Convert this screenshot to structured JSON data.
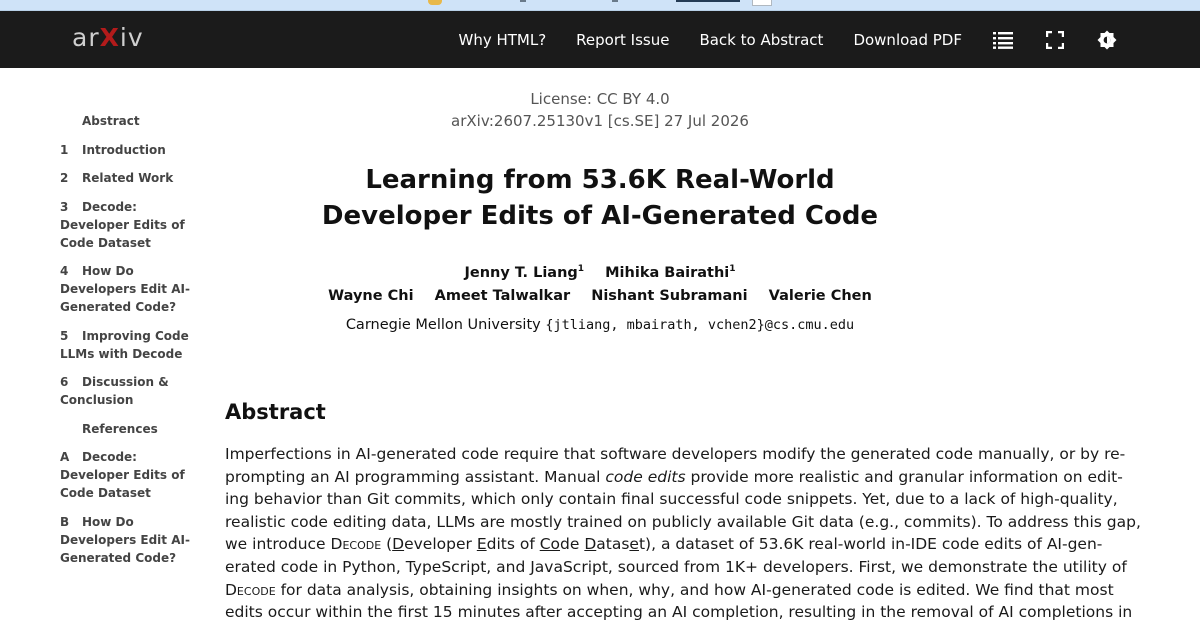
{
  "nav": {
    "logo": "arXiv",
    "links": [
      "Why HTML?",
      "Report Issue",
      "Back to Abstract",
      "Download PDF"
    ],
    "icons": [
      "list-icon",
      "fullscreen-icon",
      "settings-icon"
    ]
  },
  "toc": [
    {
      "num": "",
      "label": "Abstract"
    },
    {
      "num": "1",
      "label": "Introduction"
    },
    {
      "num": "2",
      "label": "Related Work"
    },
    {
      "num": "3",
      "label": "Decode: Developer Edits of Code Dataset"
    },
    {
      "num": "4",
      "label": "How Do Developers Edit AI-Generated Code?"
    },
    {
      "num": "5",
      "label": "Improving Code LLMs with Decode"
    },
    {
      "num": "6",
      "label": "Discussion & Conclusion"
    },
    {
      "num": "",
      "label": "References"
    },
    {
      "num": "A",
      "label": "Decode: Developer Edits of Code Dataset"
    },
    {
      "num": "B",
      "label": "How Do Developers Edit AI-Generated Code?"
    }
  ],
  "paper": {
    "license": "License: CC BY 4.0",
    "arxiv_id": "arXiv:2607.25130v1 [cs.SE] 27 Jul 2026",
    "title_line1": "Learning from 53.6K Real-World",
    "title_line2": "Developer Edits of AI-Generated Code",
    "authors_row1": [
      {
        "name": "Jenny T. Liang",
        "sup": "1"
      },
      {
        "name": "Mihika Bairathi",
        "sup": "1"
      }
    ],
    "authors_row2": [
      {
        "name": "Wayne Chi",
        "sup": ""
      },
      {
        "name": "Ameet Talwalkar",
        "sup": ""
      },
      {
        "name": "Nishant Subramani",
        "sup": ""
      },
      {
        "name": "Valerie Chen",
        "sup": ""
      }
    ],
    "affiliation": "Carnegie Mellon University",
    "emails": "{jtliang, mbairath, vchen2}@cs.cmu.edu",
    "abstract_heading": "Abstract",
    "abstract_lines": {
      "l1": "Imperfections in AI-generated code require that software developers modify the generated code manually, or by re-",
      "l2a": "prompting an AI programming assistant. Manual ",
      "l2b": "code edits",
      "l2c": " provide more realistic and granular information on edit-",
      "l3": "ing behavior than Git commits, which only contain final successful code snippets. Yet, due to a lack of high-quality,",
      "l4": "realistic code editing data, LLMs are mostly trained on publicly available Git data (e.g., commits). To address this gap,",
      "l5a": "we introduce ",
      "l5b": "Decode",
      "l5c": " (",
      "l5d": "D",
      "l5e": "eveloper ",
      "l5f": "E",
      "l5g": "dits of ",
      "l5h": "Co",
      "l5i": "de ",
      "l5j": "D",
      "l5k": "atas",
      "l5l": "e",
      "l5m": "t), a dataset of 53.6K real-world in-IDE code edits of AI-gen-",
      "l6": "erated code in Python, TypeScript, and JavaScript, sourced from 1K+ developers. First, we demonstrate the utility of",
      "l7a": "Decode",
      "l7b": " for data analysis, obtaining insights on when, why, and how AI-generated code is edited. We find that most",
      "l8": "edits occur within the first 15 minutes after accepting an AI completion, resulting in the removal of AI completions in"
    }
  }
}
